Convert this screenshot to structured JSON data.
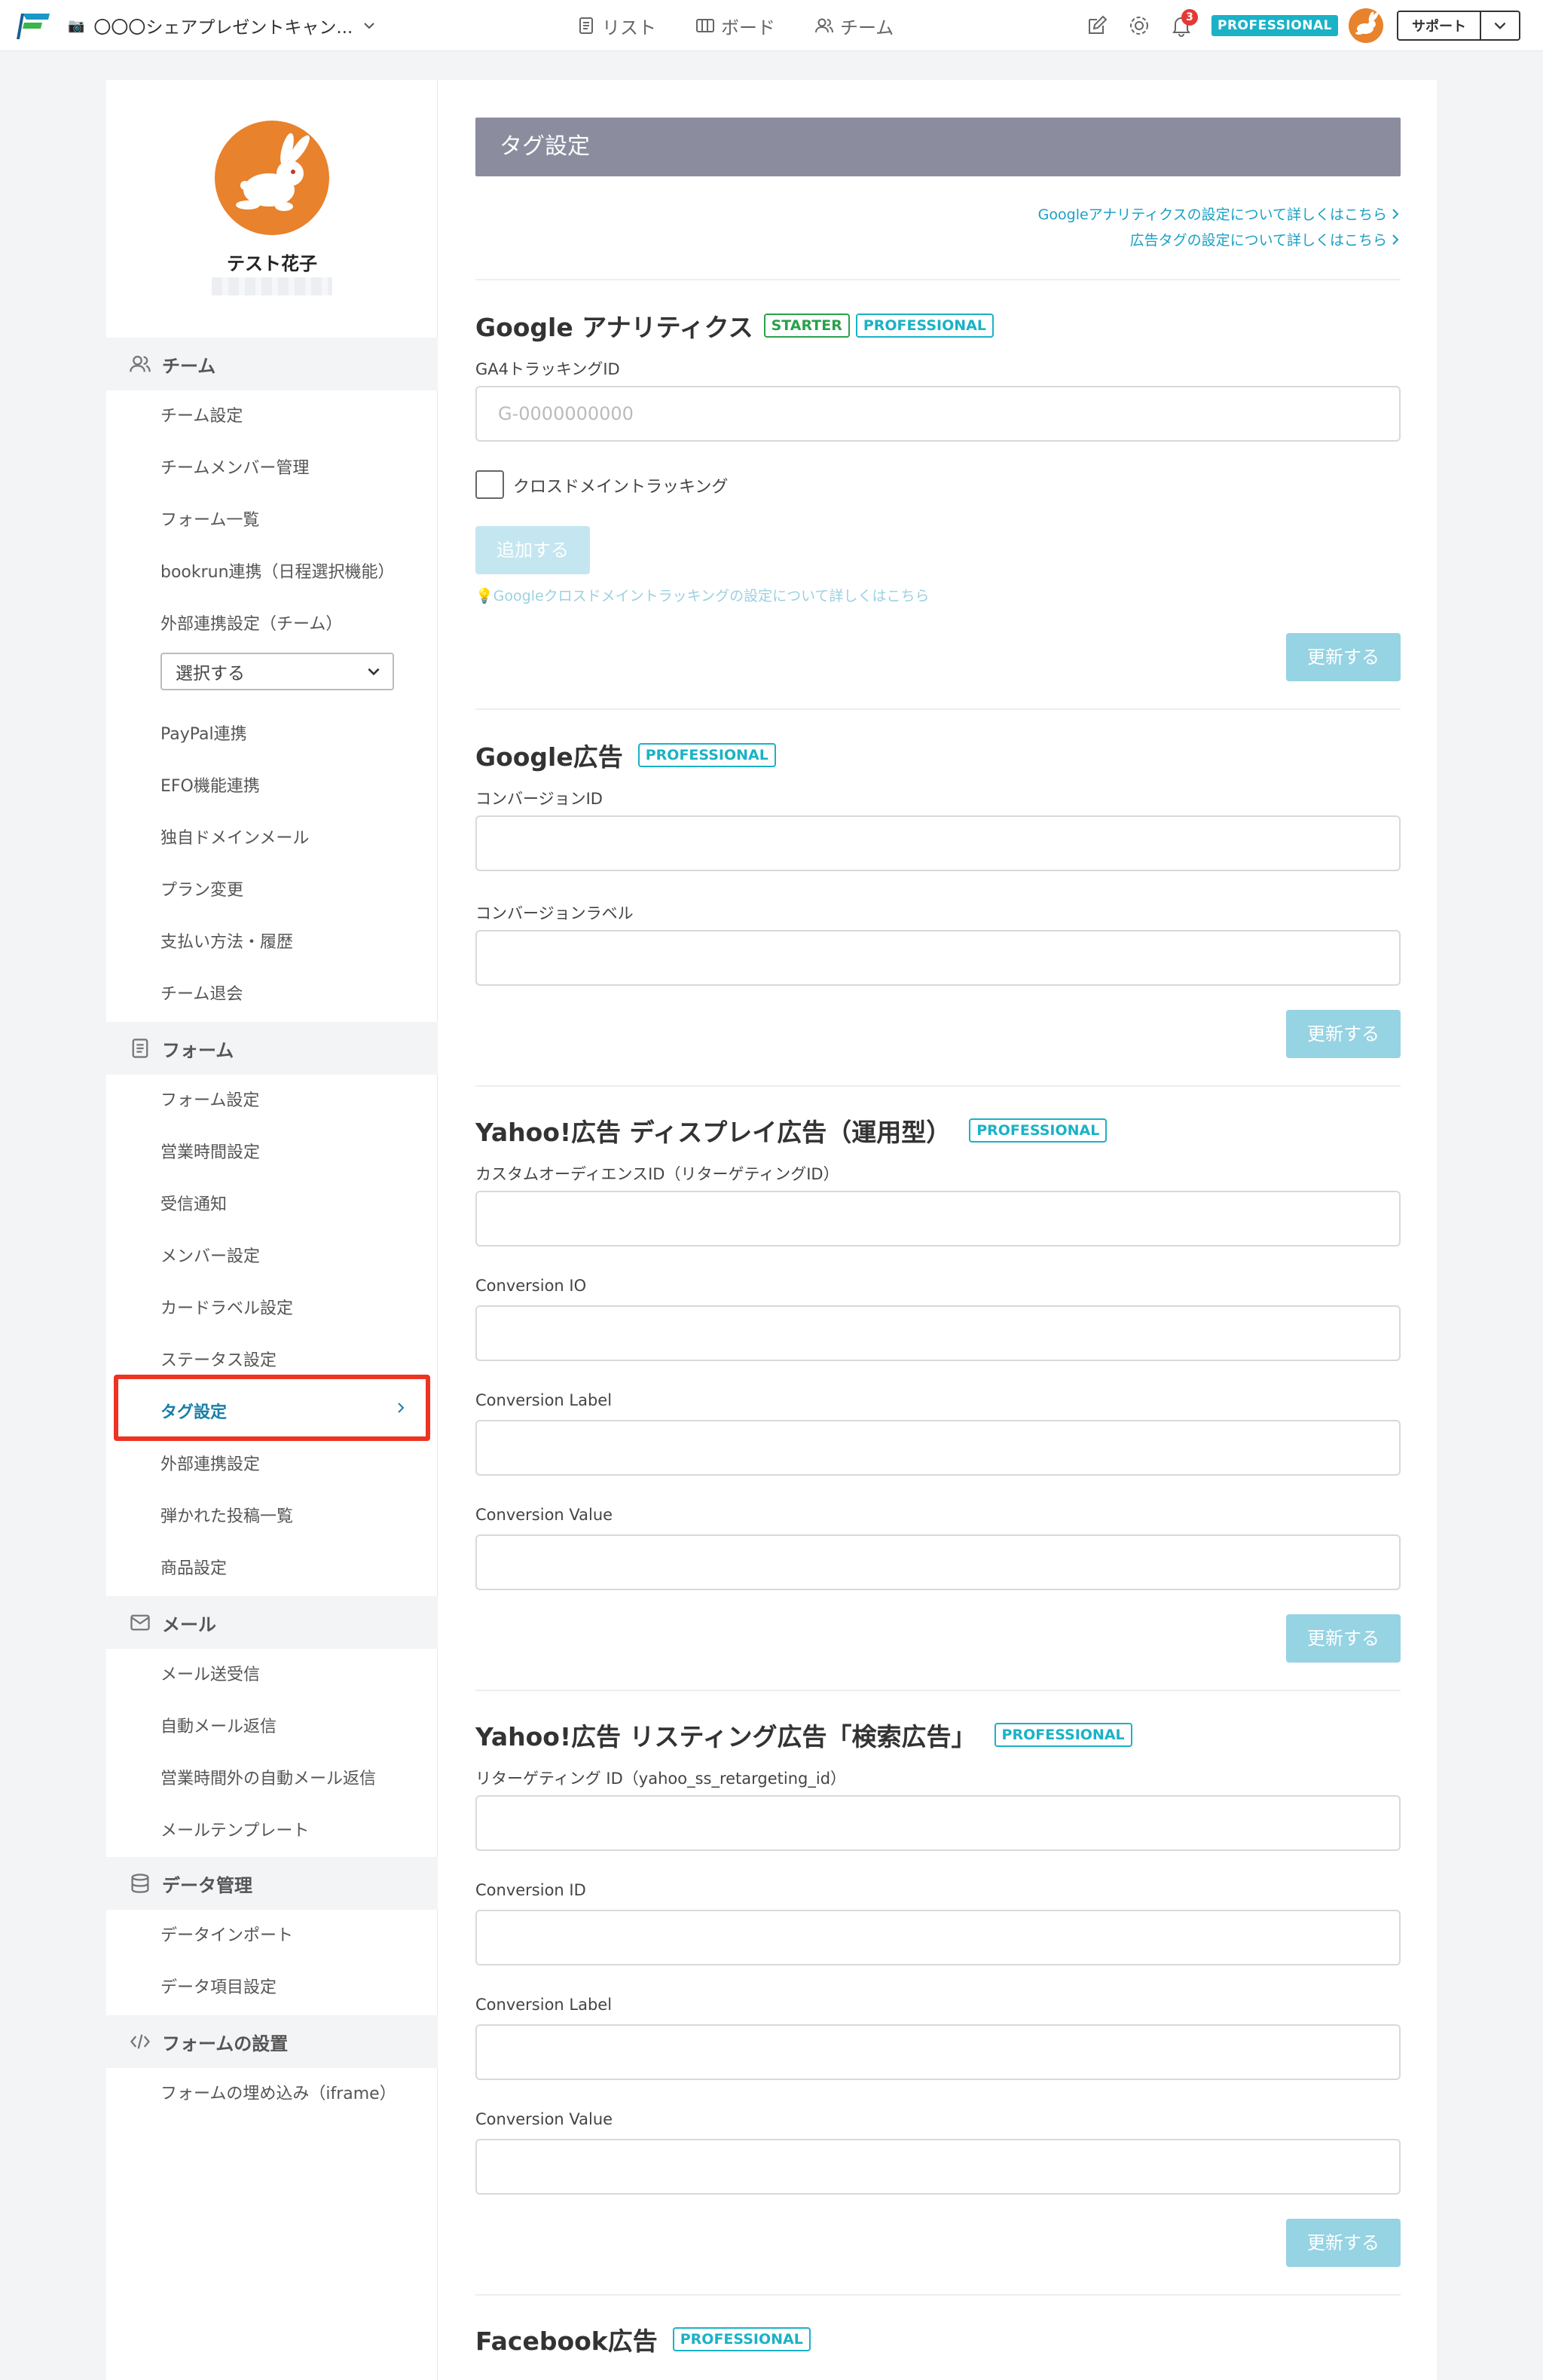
{
  "topbar": {
    "project_title": "〇〇〇シェアプレゼントキャン...",
    "nav": [
      {
        "label": "リスト",
        "icon": "list-icon"
      },
      {
        "label": "ボード",
        "icon": "board-icon"
      },
      {
        "label": "チーム",
        "icon": "team-icon"
      }
    ],
    "notification_count": "3",
    "plan_badge": "PROFESSIONAL",
    "support_label": "サポート"
  },
  "profile": {
    "name": "テスト花子"
  },
  "sidebar": {
    "sections": [
      {
        "label": "チーム",
        "icon": "team-icon"
      },
      {
        "label": "フォーム",
        "icon": "document-icon"
      },
      {
        "label": "メール",
        "icon": "mail-icon"
      },
      {
        "label": "データ管理",
        "icon": "database-icon"
      },
      {
        "label": "フォームの設置",
        "icon": "code-icon"
      }
    ],
    "team_items": [
      "チーム設定",
      "チームメンバー管理",
      "フォーム一覧",
      "bookrun連携（日程選択機能）",
      "外部連携設定（チーム）",
      "PayPal連携",
      "EFO機能連携",
      "独自ドメインメール",
      "プラン変更",
      "支払い方法・履歴",
      "チーム退会"
    ],
    "external_select": "選択する",
    "form_items": [
      "フォーム設定",
      "営業時間設定",
      "受信通知",
      "メンバー設定",
      "カードラベル設定",
      "ステータス設定",
      "タグ設定",
      "外部連携設定",
      "弾かれた投稿一覧",
      "商品設定"
    ],
    "mail_items": [
      "メール送受信",
      "自動メール返信",
      "営業時間外の自動メール返信",
      "メールテンプレート"
    ],
    "data_items": [
      "データインポート",
      "データ項目設定"
    ],
    "embed_items": [
      "フォームの埋め込み（iframe）"
    ]
  },
  "main": {
    "header": "タグ設定",
    "links": [
      "Googleアナリティクスの設定について詳しくはこちら",
      "広告タグの設定について詳しくはこちら"
    ],
    "update_label": "更新する",
    "ga": {
      "title": "Google アナリティクス",
      "badges": [
        "STARTER",
        "PROFESSIONAL"
      ],
      "field_label": "GA4トラッキングID",
      "placeholder": "G-0000000000",
      "checkbox_label": "クロスドメイントラッキング",
      "add_label": "追加する",
      "hint": "💡Googleクロスドメイントラッキングの設定について詳しくはこちら"
    },
    "gads": {
      "title": "Google広告",
      "badge": "PROFESSIONAL",
      "fields": [
        "コンバージョンID",
        "コンバージョンラベル"
      ]
    },
    "ydisplay": {
      "title": "Yahoo!広告 ディスプレイ広告（運用型）",
      "badge": "PROFESSIONAL",
      "fields": [
        "カスタムオーディエンスID（リターゲティングID）",
        "Conversion IO",
        "Conversion Label",
        "Conversion Value"
      ]
    },
    "ysearch": {
      "title": "Yahoo!広告 リスティング広告「検索広告」",
      "badge": "PROFESSIONAL",
      "fields": [
        "リターゲティング ID（yahoo_ss_retargeting_id）",
        "Conversion ID",
        "Conversion Label",
        "Conversion Value"
      ]
    },
    "fb": {
      "title": "Facebook広告",
      "badge": "PROFESSIONAL"
    }
  }
}
